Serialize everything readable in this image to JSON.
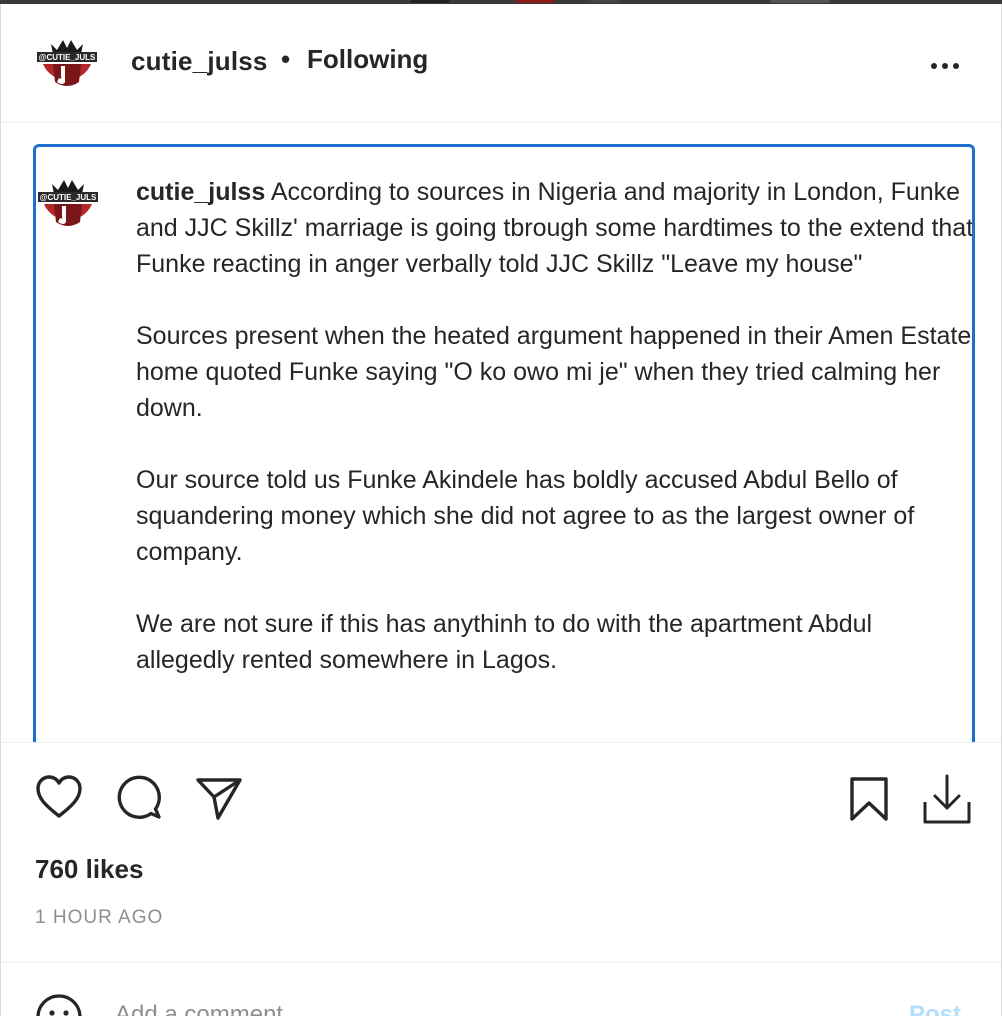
{
  "header": {
    "username": "cutie_julss",
    "bullet": "•",
    "follow_status": "Following",
    "avatar_text": "@CUTIE_JULS"
  },
  "caption": {
    "username": "cutie_julss",
    "paragraphs": [
      "According to sources in Nigeria and majority in London, Funke and JJC Skillz' marriage is going tbrough some hardtimes to the extend that Funke reacting in anger verbally told JJC Skillz \"Leave my house\"",
      "Sources present when the heated argument happened in their Amen Estate home quoted Funke saying \"O ko owo mi je\" when they tried calming her down.",
      "Our source told us Funke Akindele has boldly accused Abdul Bello of squandering money which she did not agree to as the largest owner of company.",
      "We are not sure if this has anythinh to do with the apartment Abdul allegedly rented somewhere in Lagos."
    ]
  },
  "actions": {
    "like_icon": "heart-icon",
    "comment_icon": "comment-bubble-icon",
    "share_icon": "paper-plane-icon",
    "save_icon": "bookmark-icon",
    "download_icon": "download-icon"
  },
  "likes": "760 likes",
  "timestamp": "1 HOUR AGO",
  "comment_box": {
    "placeholder": "Add a comment…",
    "post_label": "Post",
    "emoji_icon": "emoji-smiley-icon"
  },
  "colors": {
    "focus_border": "#1f6fd1",
    "text": "#262626",
    "muted": "#8e8e8e",
    "post_disabled": "#b2dffc",
    "avatar_red": "#b3262b"
  }
}
